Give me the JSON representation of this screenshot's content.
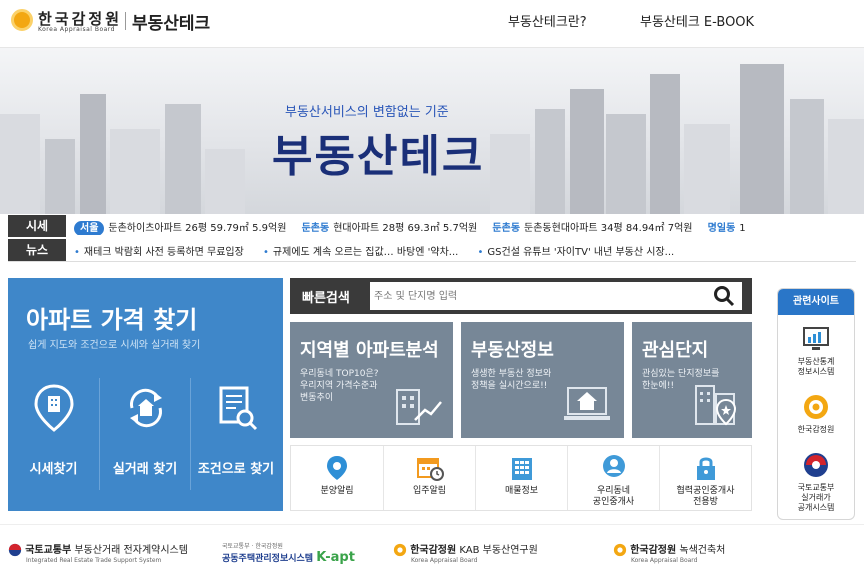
{
  "header": {
    "logo_korean": "한국감정원",
    "logo_english": "Korea Appraisal Board",
    "brand": "부동산테크",
    "nav": [
      "부동산테크란?",
      "부동산테크 E-BOOK"
    ]
  },
  "hero": {
    "subtitle": "부동산서비스의 변함없는 기준",
    "title": "부동산테크"
  },
  "ticker": {
    "price_label": "시세",
    "news_label": "뉴스",
    "prices": [
      {
        "region": "서울",
        "area": "",
        "text": "둔촌하이츠아파트 26평 59.79㎡ 5.9억원"
      },
      {
        "region": "",
        "area": "둔촌동",
        "text": "현대아파트 28평 69.3㎡ 5.7억원"
      },
      {
        "region": "",
        "area": "둔촌동",
        "text": "둔촌동현대아파트 34평 84.94㎡ 7억원"
      },
      {
        "region": "",
        "area": "명일동",
        "text": "1"
      }
    ],
    "news": [
      "재테크 박람회 사전 등록하면 무료입장",
      "규제에도 계속 오르는 집값… 바탕엔 '약차...",
      "GS건설 유튜브 '자이TV' 내년 부동산 시장..."
    ]
  },
  "apt_finder": {
    "title": "아파트 가격 찾기",
    "subtitle": "쉽게 지도와 조건으로 시세와 실거래 찾기",
    "items": [
      "시세찾기",
      "실거래 찾기",
      "조건으로 찾기"
    ]
  },
  "quick_search": {
    "label": "빠른검색",
    "placeholder": "주소 및 단지명 입력"
  },
  "cards": [
    {
      "title": "지역별 아파트분석",
      "desc": [
        "우리동네 TOP10은?",
        "우리지역 가격수준과",
        "변동추이"
      ]
    },
    {
      "title": "부동산정보",
      "desc": [
        "생생한 부동산 정보와",
        "정책을 실시간으로!!"
      ]
    },
    {
      "title": "관심단지",
      "desc": [
        "관심있는 단지정보를",
        "한눈에!!"
      ]
    }
  ],
  "icon_row": [
    {
      "label": [
        "분양알림"
      ]
    },
    {
      "label": [
        "입주알림"
      ]
    },
    {
      "label": [
        "매물정보"
      ]
    },
    {
      "label": [
        "우리동네",
        "공인중개사"
      ]
    },
    {
      "label": [
        "협력공인중개사",
        "전용방"
      ]
    }
  ],
  "related": {
    "title": "관련사이트",
    "items": [
      {
        "label": [
          "부동산통계",
          "정보시스템"
        ]
      },
      {
        "label": [
          "한국감정원"
        ]
      },
      {
        "label": [
          "국토교통부",
          "실거래가",
          "공개시스템"
        ]
      }
    ]
  },
  "footer": {
    "links": [
      {
        "org": "국토교통부",
        "name": "부동산거래 전자계약시스템",
        "sub": "Integrated Real Estate Trade Support System"
      },
      {
        "org": "공동주택관리정보시스템",
        "name": "K-apt",
        "sub": "국토교통부 · 한국감정원"
      },
      {
        "org": "한국감정원",
        "name": "KAB 부동산연구원",
        "sub": "Korea Appraisal Board"
      },
      {
        "org": "한국감정원",
        "name": "녹색건축처",
        "sub": "Korea Appraisal Board"
      }
    ]
  },
  "colors": {
    "primary_blue": "#3f87c9",
    "card_grey": "#778797",
    "title_navy": "#1a2f78",
    "accent_orange": "#f3a712"
  }
}
